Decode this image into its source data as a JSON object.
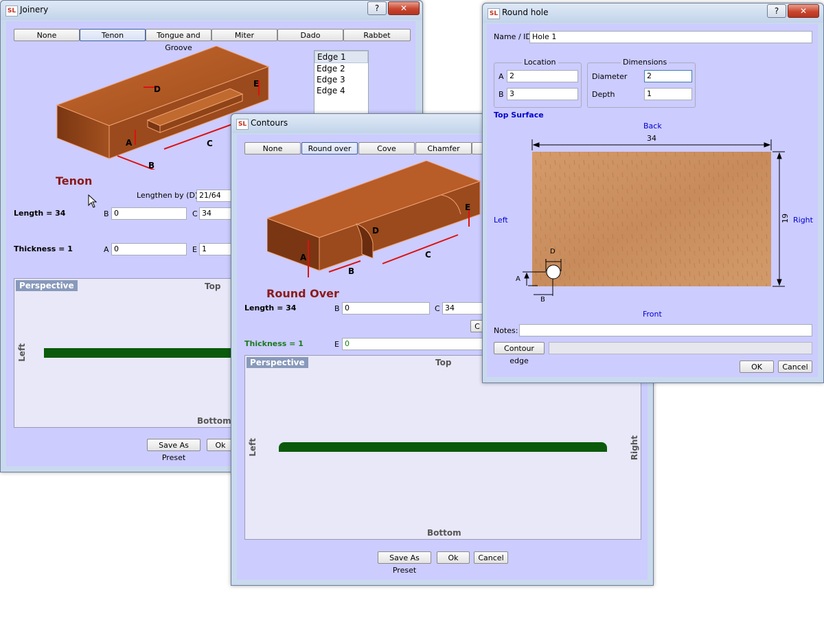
{
  "joinery": {
    "title": "Joinery",
    "tabs": [
      "None",
      "Tenon",
      "Tongue and Groove",
      "Miter",
      "Dado",
      "Rabbet"
    ],
    "edges": [
      "Edge 1",
      "Edge 2",
      "Edge 3",
      "Edge 4"
    ],
    "diagram_letters": [
      "A",
      "B",
      "C",
      "D",
      "E"
    ],
    "type_label": "Tenon",
    "lengthen_label": "Lengthen by (D) =",
    "lengthen_value": "21/64",
    "length_label": "Length = 34",
    "thickness_label": "Thickness = 1",
    "b_label": "B",
    "b_value": "0",
    "c_label": "C",
    "c_value": "34",
    "a_label": "A",
    "a_value": "0",
    "e_label": "E",
    "e_value": "1",
    "perspective": "Perspective",
    "top": "Top",
    "bottom": "Bottom",
    "left": "Left",
    "save_preset": "Save As Preset",
    "ok": "Ok"
  },
  "contours": {
    "title": "Contours",
    "tabs": [
      "None",
      "Round over",
      "Cove",
      "Chamfer"
    ],
    "diagram_letters": [
      "A",
      "B",
      "C",
      "D",
      "E"
    ],
    "type_label": "Round Over",
    "length_label": "Length = 34",
    "thickness_label": "Thickness = 1",
    "b_label": "B",
    "b_value": "0",
    "c_label": "C",
    "c_value": "34",
    "e_label": "E",
    "e_value": "0",
    "c_button": "C",
    "perspective": "Perspective",
    "top": "Top",
    "bottom": "Bottom",
    "left": "Left",
    "right": "Right",
    "save_preset": "Save As Preset",
    "ok": "Ok",
    "cancel": "Cancel"
  },
  "roundhole": {
    "title": "Round hole",
    "name_label": "Name / ID",
    "name_value": "Hole 1",
    "location_title": "Location",
    "dimensions_title": "Dimensions",
    "loc_a_label": "A",
    "loc_a_value": "2",
    "loc_b_label": "B",
    "loc_b_value": "3",
    "diameter_label": "Diameter",
    "diameter_value": "2",
    "depth_label": "Depth",
    "depth_value": "1",
    "top_surface": "Top Surface",
    "back": "Back",
    "front": "Front",
    "left": "Left",
    "right": "Right",
    "width_dim": "34",
    "height_dim": "19",
    "d_mark": "D",
    "a_mark": "A",
    "b_mark": "B",
    "notes_label": "Notes:",
    "notes_value": "",
    "contour_edge": "Contour edge",
    "ok": "OK",
    "cancel": "Cancel"
  },
  "title_buttons": {
    "help": "?",
    "close": "✕"
  },
  "colors": {
    "window_bg": "#ccccff",
    "accent_red": "#8b1a1a",
    "blue_text": "#0000cc",
    "profile_green": "#0b5a0b"
  }
}
